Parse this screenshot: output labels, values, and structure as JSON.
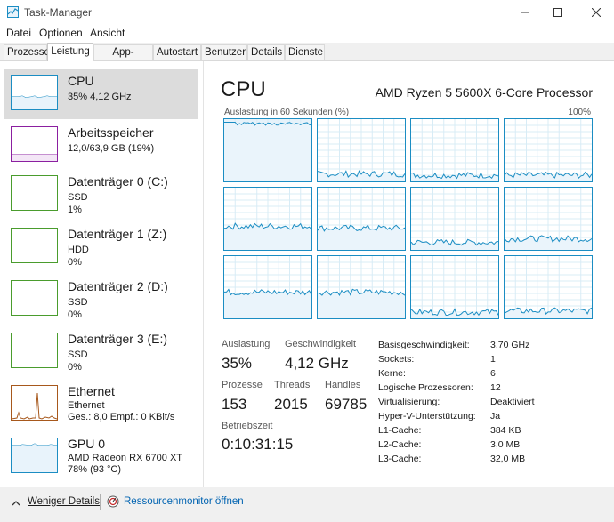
{
  "window": {
    "title": "Task-Manager"
  },
  "menu": [
    "Datei",
    "Optionen",
    "Ansicht"
  ],
  "tabs": [
    "Prozesse",
    "Leistung",
    "App-Verlauf",
    "Autostart",
    "Benutzer",
    "Details",
    "Dienste"
  ],
  "active_tab": "Leistung",
  "sidebar": [
    {
      "title": "CPU",
      "sub1": "35% 4,12 GHz",
      "sub2": "",
      "sub3": "",
      "color": "#1b8dc3"
    },
    {
      "title": "Arbeitsspeicher",
      "sub1": "12,0/63,9 GB (19%)",
      "sub2": "",
      "sub3": "",
      "color": "#8b1fa0"
    },
    {
      "title": "Datenträger 0 (C:)",
      "sub1": "SSD",
      "sub2": "1%",
      "sub3": "",
      "color": "#4a9c2d"
    },
    {
      "title": "Datenträger 1 (Z:)",
      "sub1": "HDD",
      "sub2": "0%",
      "sub3": "",
      "color": "#4a9c2d"
    },
    {
      "title": "Datenträger 2 (D:)",
      "sub1": "SSD",
      "sub2": "0%",
      "sub3": "",
      "color": "#4a9c2d"
    },
    {
      "title": "Datenträger 3 (E:)",
      "sub1": "SSD",
      "sub2": "0%",
      "sub3": "",
      "color": "#4a9c2d"
    },
    {
      "title": "Ethernet",
      "sub1": "Ethernet",
      "sub2": "Ges.: 8,0  Empf.: 0 KBit/s",
      "sub3": "",
      "color": "#a7581c"
    },
    {
      "title": "GPU 0",
      "sub1": "AMD Radeon RX 6700 XT",
      "sub2": "78% (93 °C)",
      "sub3": "",
      "color": "#1b8dc3"
    }
  ],
  "cpu": {
    "heading": "CPU",
    "model": "AMD Ryzen 5 5600X 6-Core Processor",
    "graph_label": "Auslastung in 60 Sekunden (%)",
    "graph_max": "100%",
    "stats": {
      "auslastung_label": "Auslastung",
      "auslastung_value": "35%",
      "geschwindigkeit_label": "Geschwindigkeit",
      "geschwindigkeit_value": "4,12 GHz",
      "prozesse_label": "Prozesse",
      "prozesse_value": "153",
      "threads_label": "Threads",
      "threads_value": "2015",
      "handles_label": "Handles",
      "handles_value": "69785",
      "betriebszeit_label": "Betriebszeit",
      "betriebszeit_value": "0:10:31:15"
    },
    "info": [
      {
        "label": "Basisgeschwindigkeit:",
        "value": "3,70 GHz"
      },
      {
        "label": "Sockets:",
        "value": "1"
      },
      {
        "label": "Kerne:",
        "value": "6"
      },
      {
        "label": "Logische Prozessoren:",
        "value": "12"
      },
      {
        "label": "Virtualisierung:",
        "value": "Deaktiviert"
      },
      {
        "label": "Hyper-V-Unterstützung:",
        "value": "Ja"
      },
      {
        "label": "L1-Cache:",
        "value": "384 KB"
      },
      {
        "label": "L2-Cache:",
        "value": "3,0 MB"
      },
      {
        "label": "L3-Cache:",
        "value": "32,0 MB"
      }
    ]
  },
  "footer": {
    "less_details": "Weniger Details",
    "resource_monitor": "Ressourcenmonitor öffnen"
  },
  "colors": {
    "accent": "#1b8dc3",
    "memory": "#8b1fa0",
    "disk": "#4a9c2d",
    "ethernet": "#a7581c"
  }
}
